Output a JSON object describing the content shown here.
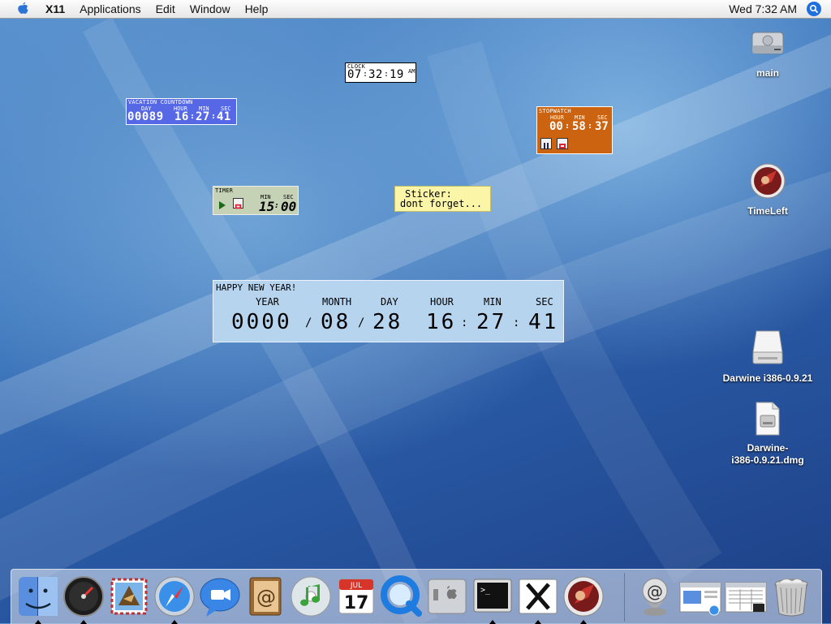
{
  "menubar": {
    "app_name": "X11",
    "items": [
      "Applications",
      "Edit",
      "Window",
      "Help"
    ],
    "clock": "Wed 7:32 AM"
  },
  "desktop_icons": {
    "main": "main",
    "timeleft": "TimeLeft",
    "darwine_volume": "Darwine i386-0.9.21",
    "darwine_dmg_line1": "Darwine-",
    "darwine_dmg_line2": "i386-0.9.21.dmg"
  },
  "vacation": {
    "title": "VACATION COUNTDOWN",
    "headers": [
      "DAY",
      "HOUR",
      "MIN",
      "SEC"
    ],
    "day": "00089",
    "hour": "16",
    "min": "27",
    "sec": "41"
  },
  "clock_widget": {
    "title": "CLOCK",
    "hour": "07",
    "min": "32",
    "sec": "19",
    "ampm": "AM"
  },
  "stopwatch": {
    "title": "STOPWATCH",
    "headers": [
      "HOUR",
      "MIN",
      "SEC"
    ],
    "hour": "00",
    "min": "58",
    "sec": "37"
  },
  "timer": {
    "title": "TIMER",
    "headers": [
      "MIN",
      "SEC"
    ],
    "min": "15",
    "sec": "00"
  },
  "sticker": {
    "line1": "Sticker:",
    "line2": "dont forget..."
  },
  "new_year": {
    "title": "HAPPY NEW YEAR!",
    "headers": [
      "YEAR",
      "MONTH",
      "DAY",
      "HOUR",
      "MIN",
      "SEC"
    ],
    "year": "0000",
    "month": "08",
    "day": "28",
    "hour": "16",
    "min": "27",
    "sec": "41"
  },
  "dock": {
    "apps": [
      "finder-icon",
      "dashboard-icon",
      "mail-icon",
      "safari-icon",
      "ichat-icon",
      "address-book-icon",
      "itunes-icon",
      "ical-icon",
      "quicktime-icon",
      "system-preferences-icon",
      "terminal-icon",
      "x11-icon",
      "timeleft-icon"
    ],
    "ical_month": "JUL",
    "ical_day": "17",
    "right": [
      "internet-location-icon",
      "window-minimized-icon",
      "window-minimized-2-icon",
      "trash-icon"
    ]
  }
}
